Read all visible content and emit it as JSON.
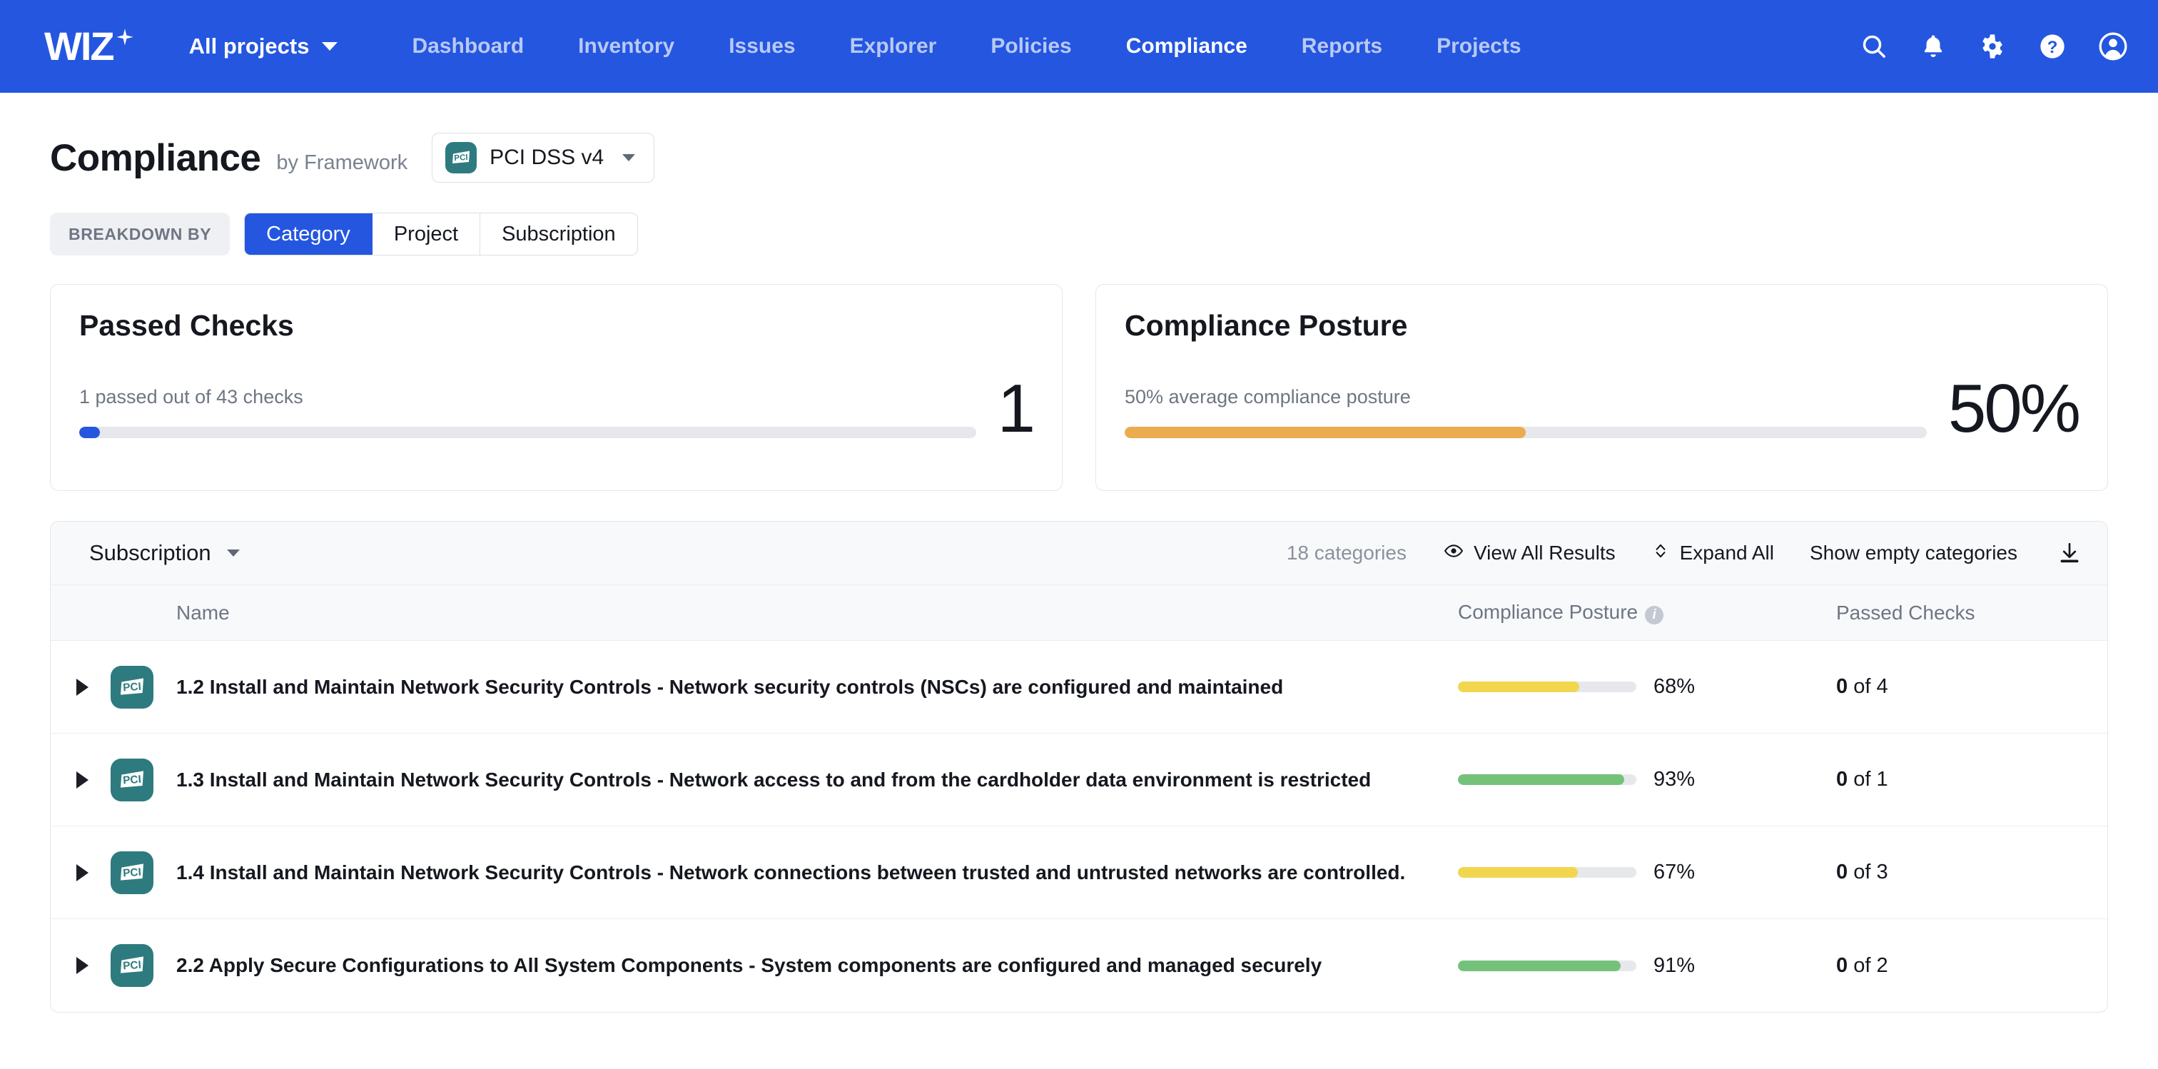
{
  "nav": {
    "logo_text": "WIZ",
    "logo_icon": "sparkle-icon",
    "projects_selector": "All projects",
    "links": [
      {
        "label": "Dashboard",
        "active": false
      },
      {
        "label": "Inventory",
        "active": false
      },
      {
        "label": "Issues",
        "active": false
      },
      {
        "label": "Explorer",
        "active": false
      },
      {
        "label": "Policies",
        "active": false
      },
      {
        "label": "Compliance",
        "active": true
      },
      {
        "label": "Reports",
        "active": false
      },
      {
        "label": "Projects",
        "active": false
      }
    ],
    "icons": [
      "search-icon",
      "bell-icon",
      "gear-icon",
      "help-icon",
      "user-avatar-icon"
    ]
  },
  "header": {
    "title": "Compliance",
    "subtitle": "by Framework",
    "framework": "PCI DSS v4",
    "framework_badge": "pci-badge-icon"
  },
  "breakdown": {
    "label": "BREAKDOWN BY",
    "tabs": [
      {
        "label": "Category",
        "active": true
      },
      {
        "label": "Project",
        "active": false
      },
      {
        "label": "Subscription",
        "active": false
      }
    ]
  },
  "cards": [
    {
      "title": "Passed Checks",
      "subtitle": "1 passed out of 43 checks",
      "value": "1",
      "progress_pct": 2.3,
      "bar_color": "#2456E0"
    },
    {
      "title": "Compliance Posture",
      "subtitle": "50% average compliance posture",
      "value": "50%",
      "progress_pct": 50,
      "bar_color": "#EBAC50"
    }
  ],
  "toolbar": {
    "group_by": "Subscription",
    "count": "18 categories",
    "view_all_results": "View All Results",
    "expand_all": "Expand All",
    "show_empty": "Show empty categories",
    "download_icon": "download-icon"
  },
  "table": {
    "columns": {
      "name": "Name",
      "posture": "Compliance Posture",
      "passed": "Passed Checks"
    },
    "rows": [
      {
        "name": "1.2 Install and Maintain Network Security Controls - Network security controls (NSCs) are configured and maintained",
        "posture_pct": 68,
        "posture_label": "68%",
        "bar_color": "#F2D64F",
        "passed": "0",
        "passed_of": "of 4"
      },
      {
        "name": "1.3 Install and Maintain Network Security Controls - Network access to and from the cardholder data environment is restricted",
        "posture_pct": 93,
        "posture_label": "93%",
        "bar_color": "#74C27A",
        "passed": "0",
        "passed_of": "of 1"
      },
      {
        "name": "1.4 Install and Maintain Network Security Controls - Network connections between trusted and untrusted networks are controlled.",
        "posture_pct": 67,
        "posture_label": "67%",
        "bar_color": "#F2D64F",
        "passed": "0",
        "passed_of": "of 3"
      },
      {
        "name": "2.2 Apply Secure Configurations to All System Components - System components are configured and managed securely",
        "posture_pct": 91,
        "posture_label": "91%",
        "bar_color": "#74C27A",
        "passed": "0",
        "passed_of": "of 2"
      }
    ]
  },
  "colors": {
    "brand_blue": "#2456E0",
    "teal_badge": "#2E7B7F",
    "yellow": "#F2D64F",
    "green": "#74C27A",
    "orange": "#EBAC50"
  }
}
